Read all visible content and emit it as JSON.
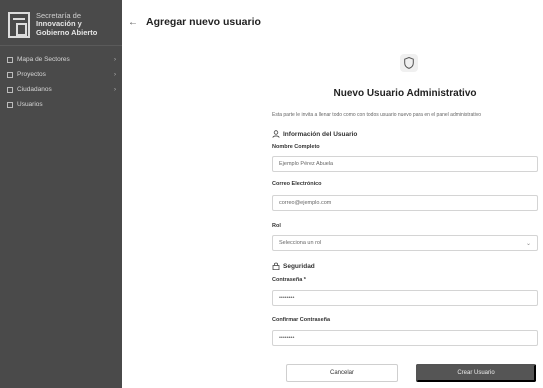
{
  "app": {
    "logo_lines": [
      "Secretaría de",
      "Innovación y",
      "Gobierno Abierto"
    ]
  },
  "sidebar": {
    "items": [
      {
        "label": "Mapa de Sectores",
        "icon": "map-icon"
      },
      {
        "label": "Proyectos",
        "icon": "folder-icon"
      },
      {
        "label": "Ciudadanos",
        "icon": "people-icon"
      },
      {
        "label": "Usuarios",
        "icon": "user-icon"
      }
    ]
  },
  "header": {
    "back_icon": "←",
    "title": "Agregar nuevo usuario"
  },
  "form": {
    "title": "Nuevo Usuario Administrativo",
    "description": "Esta parte le invita a llenar todo como con todos usuario nuevo para en el panel administrativo",
    "section_info": "Información del Usuario",
    "section_security": "Seguridad",
    "name_label": "Nombre Completo",
    "name_value": "Ejemplo Pérez Abuela",
    "email_label": "Correo Electrónico",
    "email_value": "correo@ejemplo.com",
    "role_label": "Rol",
    "role_value": "Selecciona un rol",
    "password_label": "Contraseña *",
    "password_value": "••••••••",
    "confirm_label": "Confirmar Contraseña",
    "confirm_value": "••••••••",
    "cancel_label": "Cancelar",
    "submit_label": "Crear Usuario"
  },
  "colors": {
    "sidebar_bg": "#4a4a4a",
    "primary_button": "#555555"
  }
}
